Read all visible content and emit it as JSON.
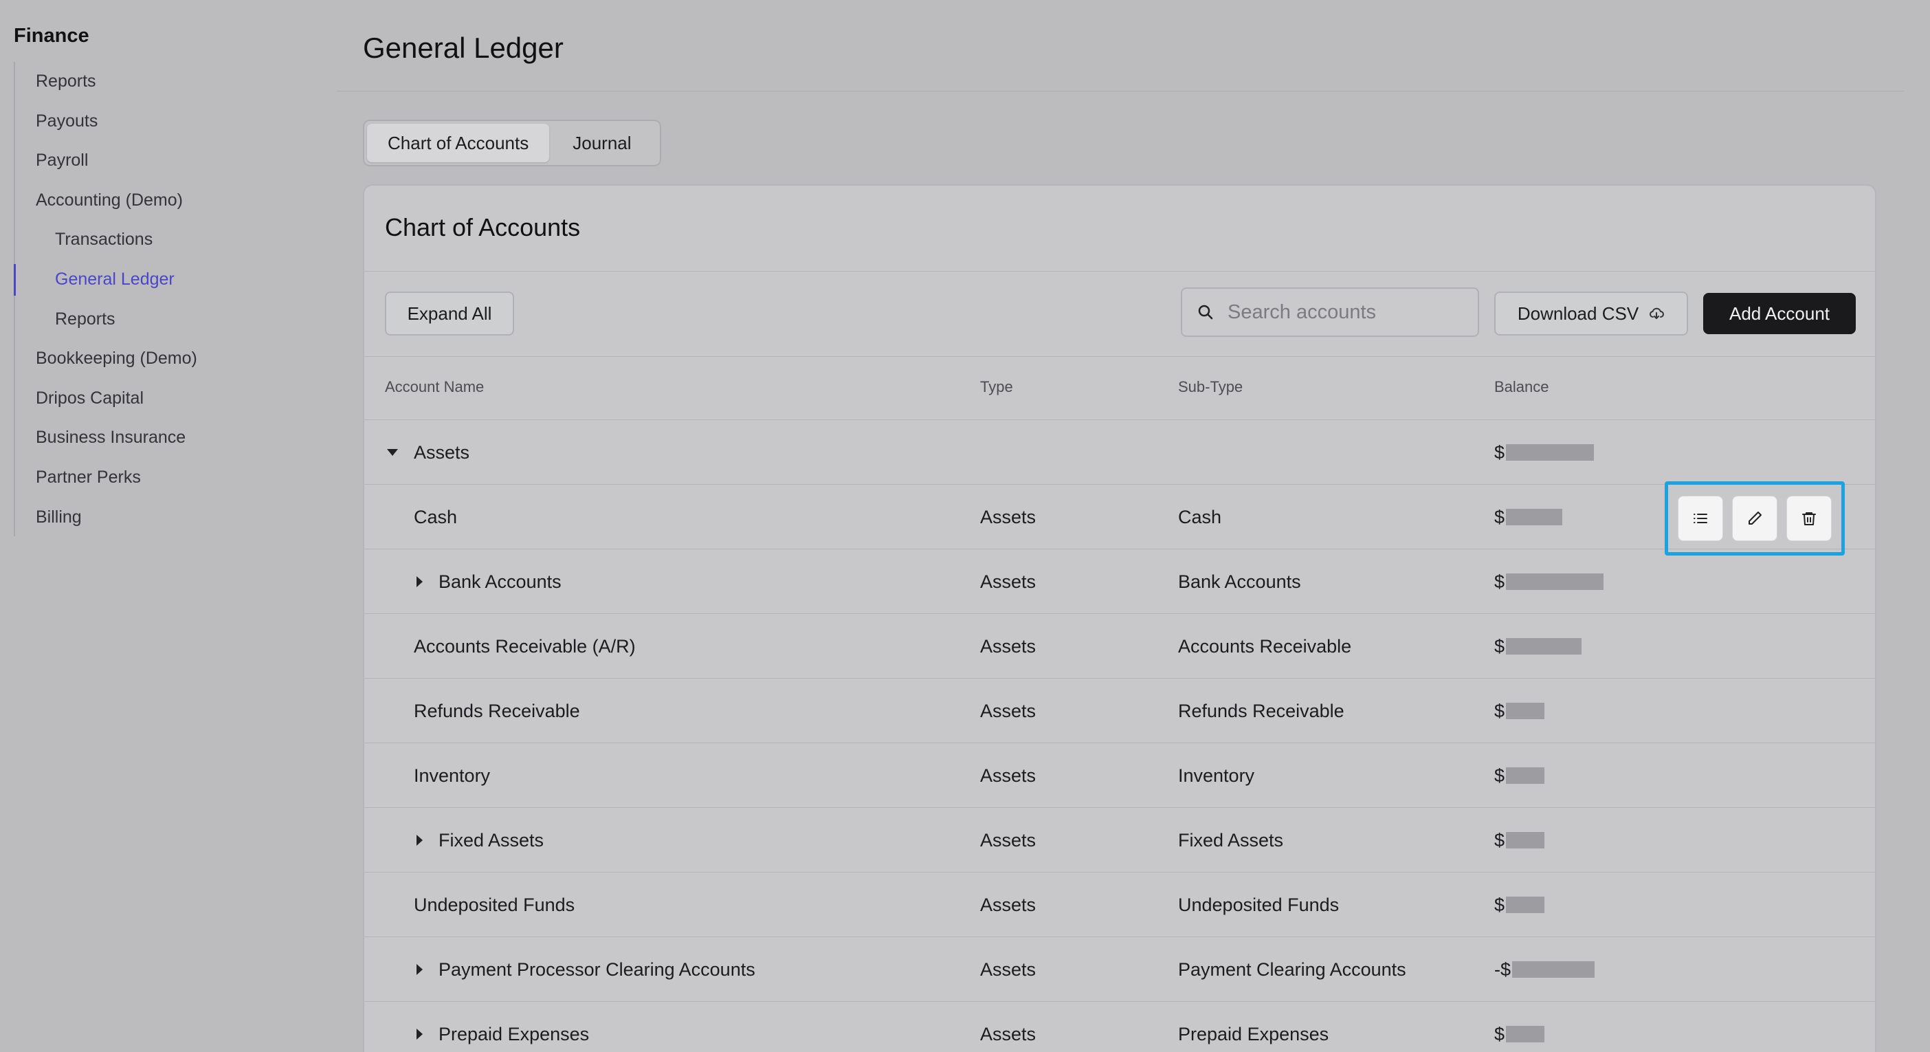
{
  "sidebar": {
    "title": "Finance",
    "items": [
      {
        "label": "Reports"
      },
      {
        "label": "Payouts"
      },
      {
        "label": "Payroll"
      },
      {
        "label": "Accounting (Demo)"
      },
      {
        "label": "Transactions"
      },
      {
        "label": "General Ledger"
      },
      {
        "label": "Reports"
      },
      {
        "label": "Bookkeeping (Demo)"
      },
      {
        "label": "Dripos Capital"
      },
      {
        "label": "Business Insurance"
      },
      {
        "label": "Partner Perks"
      },
      {
        "label": "Billing"
      }
    ]
  },
  "page": {
    "title": "General Ledger"
  },
  "tabs": [
    {
      "label": "Chart of Accounts",
      "active": true
    },
    {
      "label": "Journal",
      "active": false
    }
  ],
  "card": {
    "title": "Chart of Accounts",
    "expand_label": "Expand All",
    "search_placeholder": "Search accounts",
    "download_label": "Download CSV",
    "add_label": "Add Account"
  },
  "table": {
    "headers": [
      "Account Name",
      "Type",
      "Sub-Type",
      "Balance"
    ],
    "rows": [
      {
        "name": "Assets",
        "type": "",
        "subtype": "",
        "balance_prefix": "$",
        "caret": "down"
      },
      {
        "name": "Cash",
        "type": "Assets",
        "subtype": "Cash",
        "balance_prefix": "$",
        "caret": ""
      },
      {
        "name": "Bank Accounts",
        "type": "Assets",
        "subtype": "Bank Accounts",
        "balance_prefix": "$",
        "caret": "right"
      },
      {
        "name": "Accounts Receivable (A/R)",
        "type": "Assets",
        "subtype": "Accounts Receivable",
        "balance_prefix": "$",
        "caret": ""
      },
      {
        "name": "Refunds Receivable",
        "type": "Assets",
        "subtype": "Refunds Receivable",
        "balance_prefix": "$",
        "caret": ""
      },
      {
        "name": "Inventory",
        "type": "Assets",
        "subtype": "Inventory",
        "balance_prefix": "$",
        "caret": ""
      },
      {
        "name": "Fixed Assets",
        "type": "Assets",
        "subtype": "Fixed Assets",
        "balance_prefix": "$",
        "caret": "right"
      },
      {
        "name": "Undeposited Funds",
        "type": "Assets",
        "subtype": "Undeposited Funds",
        "balance_prefix": "$",
        "caret": ""
      },
      {
        "name": "Payment Processor Clearing Accounts",
        "type": "Assets",
        "subtype": "Payment Clearing Accounts",
        "balance_prefix": "-$",
        "caret": "right"
      },
      {
        "name": "Prepaid Expenses",
        "type": "Assets",
        "subtype": "Prepaid Expenses",
        "balance_prefix": "$",
        "caret": "right"
      }
    ]
  },
  "row_actions": {
    "icons": [
      "list-icon",
      "pencil-icon",
      "trash-icon"
    ]
  },
  "colors": {
    "accent": "#4a46c8",
    "highlight": "#1aa3e0",
    "primary_button": "#1a1a1c"
  }
}
